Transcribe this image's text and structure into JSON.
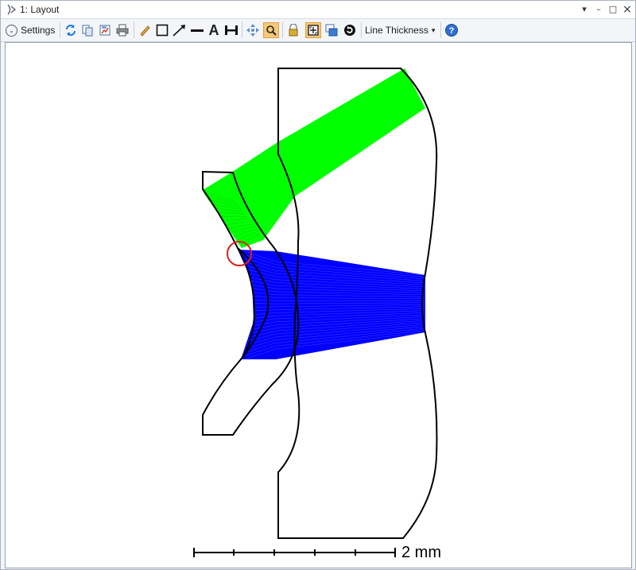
{
  "window": {
    "title": "1: Layout",
    "minimize_glyph": "▾",
    "restore_glyph": "–",
    "maximize_glyph": "□",
    "close_glyph": "×"
  },
  "toolbar": {
    "settings_label": "Settings",
    "line_thickness_label": "Line Thickness",
    "line_thickness_caret": "▾",
    "text_tool_glyph": "A",
    "help_glyph": "?",
    "icons": [
      "chevron-down-icon",
      "refresh-icon",
      "copy-icon",
      "save-icon",
      "print-icon",
      "pencil-icon",
      "rectangle-icon",
      "arrow-icon",
      "line-icon",
      "text-icon",
      "dimension-icon",
      "pan-icon",
      "zoom-icon",
      "lock-icon",
      "fit-window-icon",
      "clone-window-icon",
      "rotate-icon",
      "help-icon"
    ]
  },
  "layout": {
    "scale_label": "2 mm",
    "ray_colors": {
      "field1": "#0000ff",
      "field2": "#00ff00"
    },
    "annotation_color": "#e02020"
  }
}
